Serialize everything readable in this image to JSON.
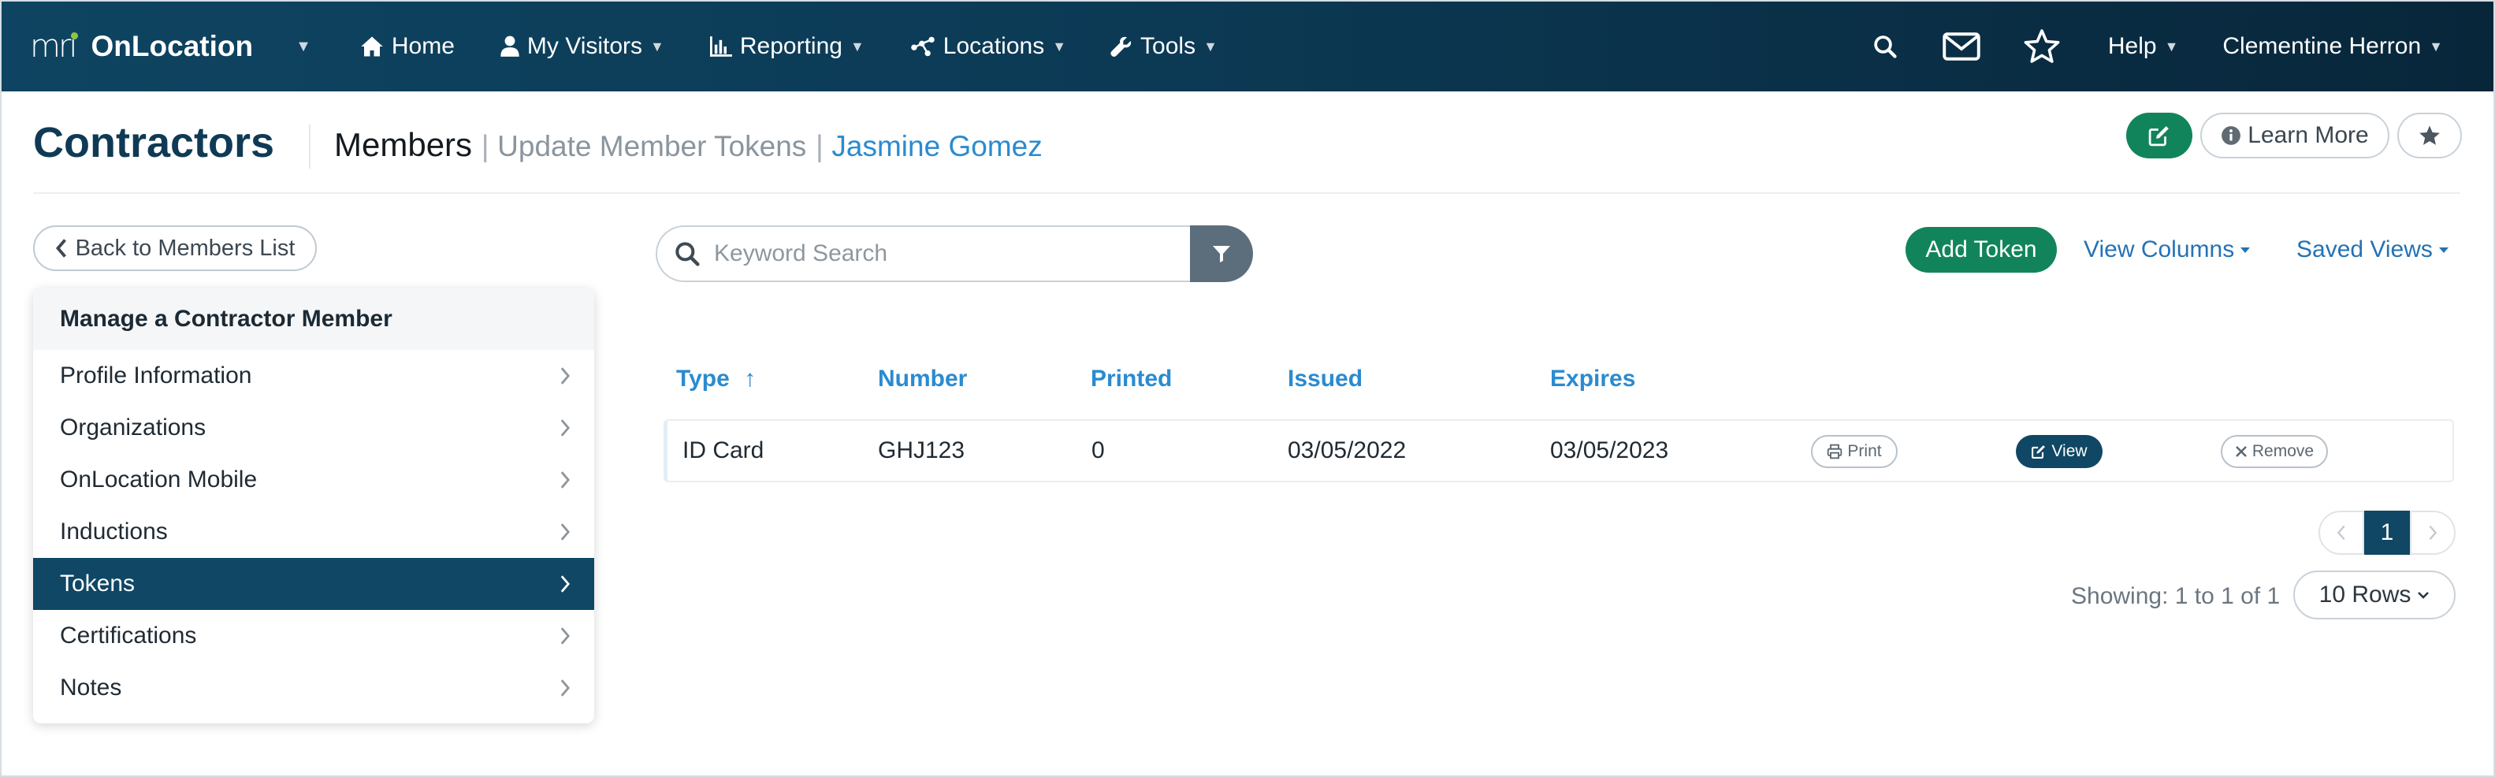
{
  "nav": {
    "brand_logo": "mri",
    "brand_name": "OnLocation",
    "items": [
      {
        "label": "Home",
        "icon": "home-icon"
      },
      {
        "label": "My Visitors",
        "icon": "user-icon"
      },
      {
        "label": "Reporting",
        "icon": "bar-chart-icon"
      },
      {
        "label": "Locations",
        "icon": "network-icon"
      },
      {
        "label": "Tools",
        "icon": "wrench-icon"
      }
    ],
    "help_label": "Help",
    "user_name": "Clementine Herron",
    "colors": {
      "bar_start": "#0e4461",
      "bar_end": "#08263a",
      "logo_dot": "#8cc63f"
    }
  },
  "header": {
    "title": "Contractors",
    "crumb_members": "Members",
    "crumb_update": "Update Member Tokens",
    "crumb_person": "Jasmine Gomez",
    "learn_more_label": "Learn More"
  },
  "sidebar": {
    "back_label": "Back to Members List",
    "heading": "Manage a Contractor Member",
    "items": [
      {
        "label": "Profile Information",
        "active": false
      },
      {
        "label": "Organizations",
        "active": false
      },
      {
        "label": "OnLocation Mobile",
        "active": false
      },
      {
        "label": "Inductions",
        "active": false
      },
      {
        "label": "Tokens",
        "active": true
      },
      {
        "label": "Certifications",
        "active": false
      },
      {
        "label": "Notes",
        "active": false
      }
    ]
  },
  "toolbar": {
    "search_placeholder": "Keyword Search",
    "add_label": "Add Token",
    "view_columns_label": "View Columns",
    "saved_views_label": "Saved Views",
    "colors": {
      "primary": "#12845b",
      "link": "#2472b4"
    }
  },
  "table": {
    "headers": [
      "Type",
      "Number",
      "Printed",
      "Issued",
      "Expires"
    ],
    "sort_indicator": "↑",
    "rows": [
      {
        "type": "ID Card",
        "number": "GHJ123",
        "printed": "0",
        "issued": "03/05/2022",
        "expires": "03/05/2023"
      }
    ],
    "actions": {
      "print": "Print",
      "view": "View",
      "remove": "Remove"
    }
  },
  "pagination": {
    "current_page": "1",
    "showing_text": "Showing: 1 to 1 of 1",
    "rows_label": "10 Rows"
  }
}
